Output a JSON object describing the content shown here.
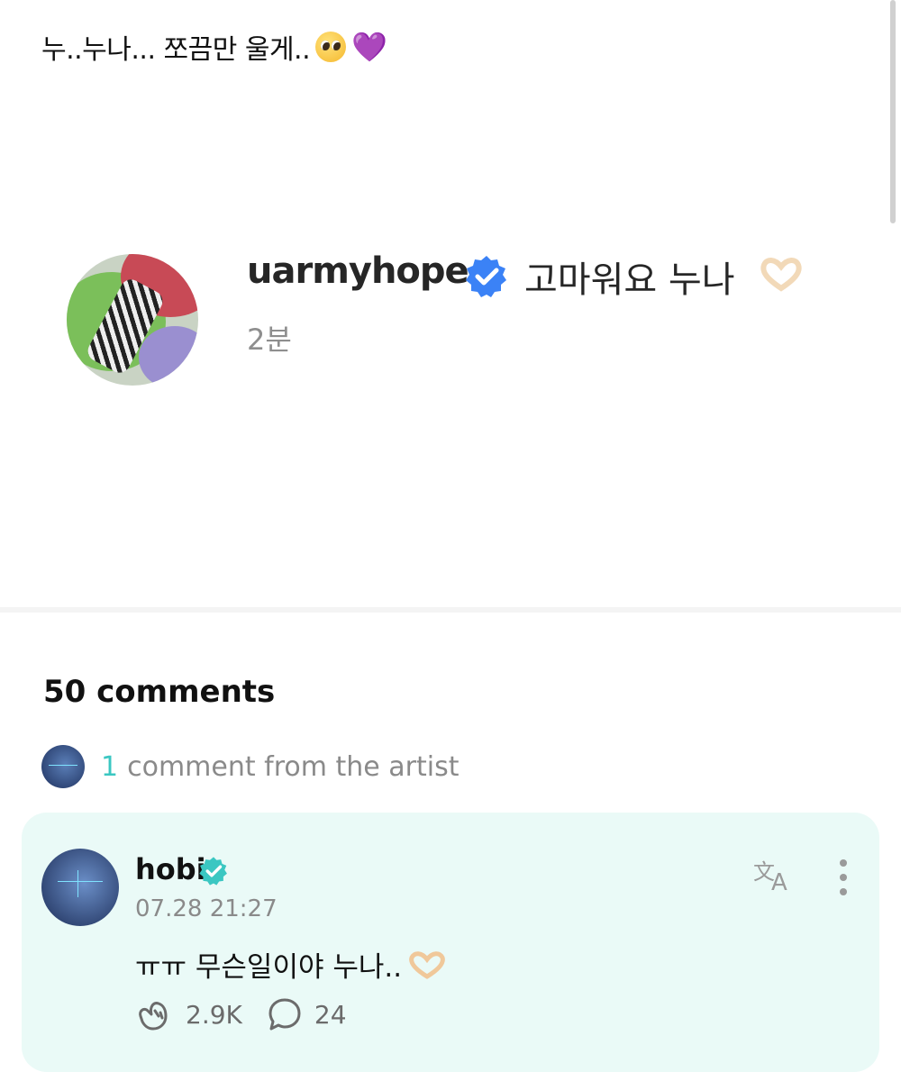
{
  "post": {
    "text": "누..누나... 쪼끔만 울게..",
    "emoji_1": "pleading-face",
    "emoji_2": "💜"
  },
  "embed": {
    "username": "uarmyhope",
    "reply": "고마워요 누나",
    "time": "2분",
    "verified_color": "#3b82f6"
  },
  "comments": {
    "count_label": "50 comments",
    "artist_count": "1",
    "artist_label": "comment from the artist"
  },
  "artist_comment": {
    "author": "hobi",
    "time": "07.28 21:27",
    "text": "ㅠㅠ 무슨일이야 누나..",
    "likes": "2.9K",
    "replies": "24",
    "card_color": "#eafaf7",
    "verified_color": "#3bc7c2"
  }
}
